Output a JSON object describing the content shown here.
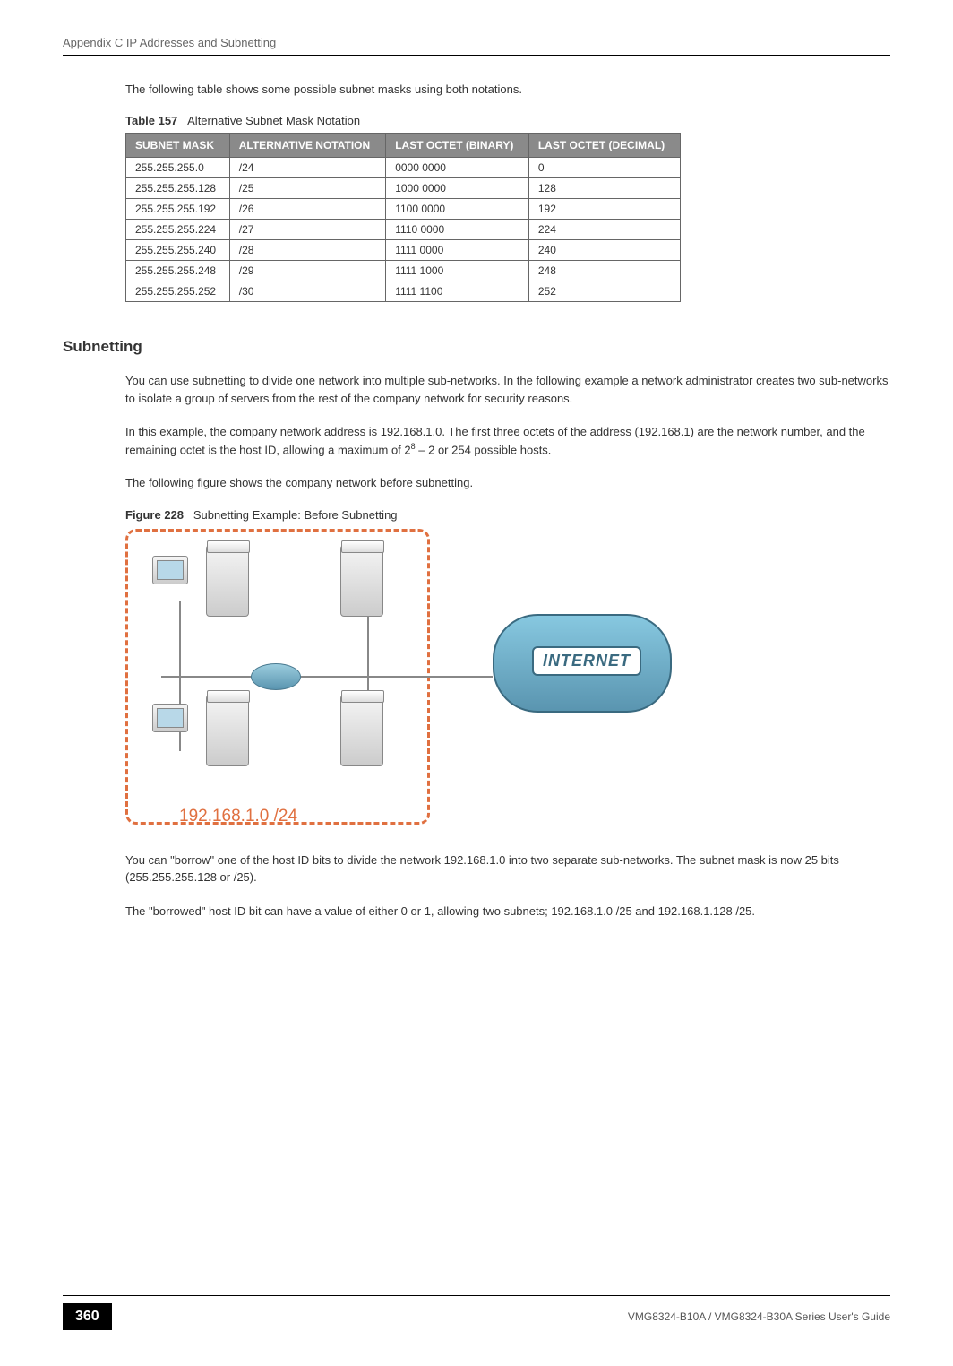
{
  "header": {
    "appendix_line": "Appendix C IP Addresses and Subnetting"
  },
  "intro": "The following table shows some possible subnet masks using both notations.",
  "table": {
    "caption_number": "Table 157",
    "caption_text": "Alternative Subnet Mask Notation",
    "headers": [
      "SUBNET MASK",
      "ALTERNATIVE NOTATION",
      "LAST OCTET (BINARY)",
      "LAST OCTET (DECIMAL)"
    ],
    "rows": [
      [
        "255.255.255.0",
        "/24",
        "0000 0000",
        "0"
      ],
      [
        "255.255.255.128",
        "/25",
        "1000 0000",
        "128"
      ],
      [
        "255.255.255.192",
        "/26",
        "1100 0000",
        "192"
      ],
      [
        "255.255.255.224",
        "/27",
        "1110 0000",
        "224"
      ],
      [
        "255.255.255.240",
        "/28",
        "1111 0000",
        "240"
      ],
      [
        "255.255.255.248",
        "/29",
        "1111 1000",
        "248"
      ],
      [
        "255.255.255.252",
        "/30",
        "1111 1100",
        "252"
      ]
    ]
  },
  "section": {
    "heading": "Subnetting",
    "para1": "You can use subnetting to divide one network into multiple sub-networks. In the following example a network administrator creates two sub-networks to isolate a group of servers from the rest of the company network for security reasons.",
    "para2_pre": "In this example, the company network address is 192.168.1.0. The first three octets of the address (192.168.1) are the network number, and the remaining octet is the host ID, allowing a maximum of 2",
    "para2_sup": "8",
    "para2_post": " – 2 or 254 possible hosts.",
    "para3": "The following figure shows the company network before subnetting."
  },
  "figure": {
    "caption_number": "Figure 228",
    "caption_text": "Subnetting Example: Before Subnetting",
    "subnet_label": "192.168.1.0 /24",
    "cloud_label": "INTERNET"
  },
  "after_figure": {
    "para1": "You can \"borrow\" one of the host ID bits to divide the network 192.168.1.0 into two separate sub-networks. The subnet mask is now 25 bits (255.255.255.128 or /25).",
    "para2": "The \"borrowed\" host ID bit can have a value of either 0 or 1, allowing two subnets; 192.168.1.0 /25 and 192.168.1.128 /25."
  },
  "footer": {
    "page": "360",
    "guide": "VMG8324-B10A / VMG8324-B30A Series User's Guide"
  }
}
